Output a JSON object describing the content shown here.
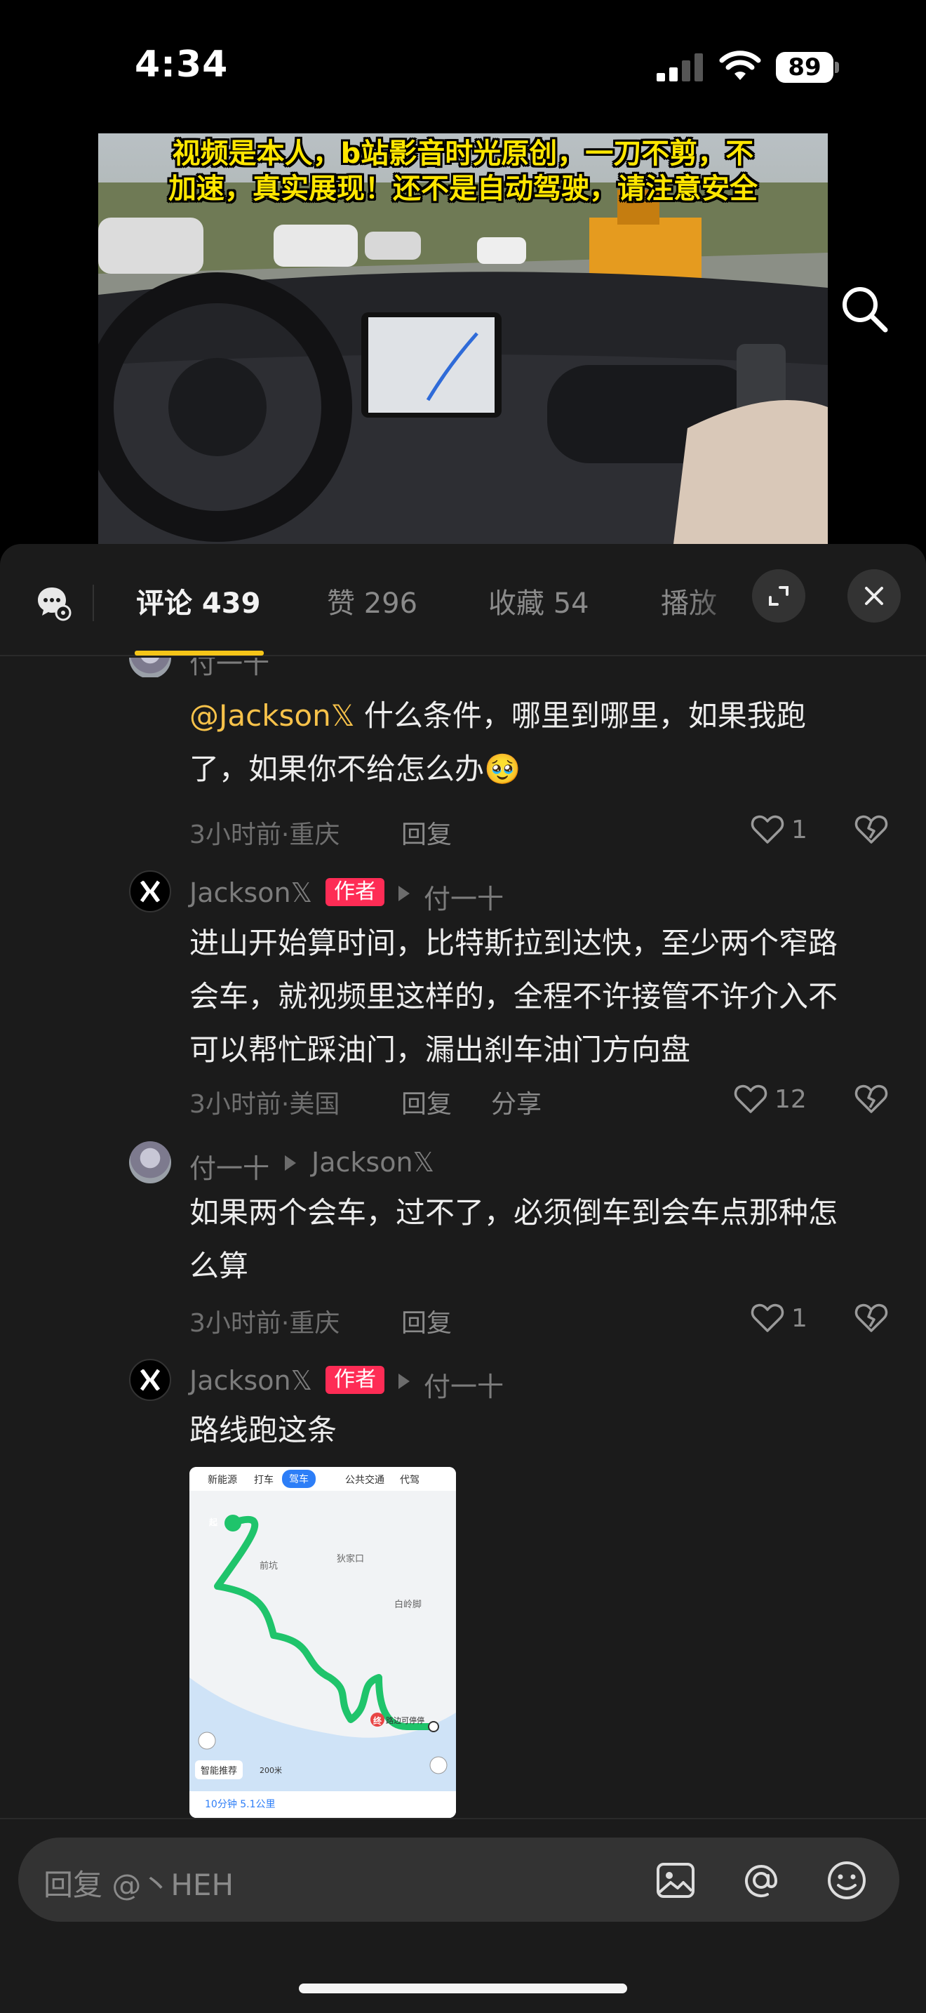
{
  "status_bar": {
    "time": "4:34",
    "battery": "89"
  },
  "video": {
    "caption_line1": "视频是本人，b站影音时光原创，一刀不剪，不",
    "caption_line2": "加速，真实展现！还不是自动驾驶，请注意安全"
  },
  "tabs": [
    {
      "label": "评论 439",
      "active": true
    },
    {
      "label": "赞 296",
      "active": false
    },
    {
      "label": "收藏 54",
      "active": false
    },
    {
      "label": "播放",
      "active": false
    }
  ],
  "comments": [
    {
      "author": "付一十",
      "mention": "@Jackson𝕏",
      "text_line1": " 什么条件，哪里到哪里，如果我跑",
      "text_line2": "了，如果你不给怎么办🥹",
      "meta": "3小时前·重庆",
      "reply_label": "回复",
      "likes": "1"
    },
    {
      "author": "Jackson𝕏",
      "badge": "作者",
      "reply_to": "付一十",
      "text_line1": "进山开始算时间，比特斯拉到达快，至少两个窄路",
      "text_line2": "会车，就视频里这样的，全程不许接管不许介入不",
      "text_line3": "可以帮忙踩油门，漏出刹车油门方向盘",
      "meta": "3小时前·美国",
      "reply_label": "回复",
      "share_label": "分享",
      "likes": "12"
    },
    {
      "author": "付一十",
      "reply_to": "Jackson𝕏",
      "text_line1": "如果两个会车，过不了，必须倒车到会车点那种怎",
      "text_line2": "么算",
      "meta": "3小时前·重庆",
      "reply_label": "回复",
      "likes": "1"
    },
    {
      "author": "Jackson𝕏",
      "badge": "作者",
      "reply_to": "付一十",
      "text_line1": "路线跑这条"
    }
  ],
  "map": {
    "tabs": [
      "新能源",
      "打车",
      "驾车",
      "公共交通",
      "代驾"
    ],
    "labels": [
      "狄家口",
      "白岭脚",
      "前坑",
      "路边可停停"
    ],
    "start": "起",
    "end": "终",
    "smart_label": "智能推荐",
    "scale": "200米",
    "summary": "10分钟  5.1公里"
  },
  "input": {
    "placeholder": "回复 @丶HEH"
  },
  "colors": {
    "accent": "#f5c518",
    "badge": "#fe2c55",
    "mention": "#f7c24a",
    "route": "#1fc46b"
  }
}
